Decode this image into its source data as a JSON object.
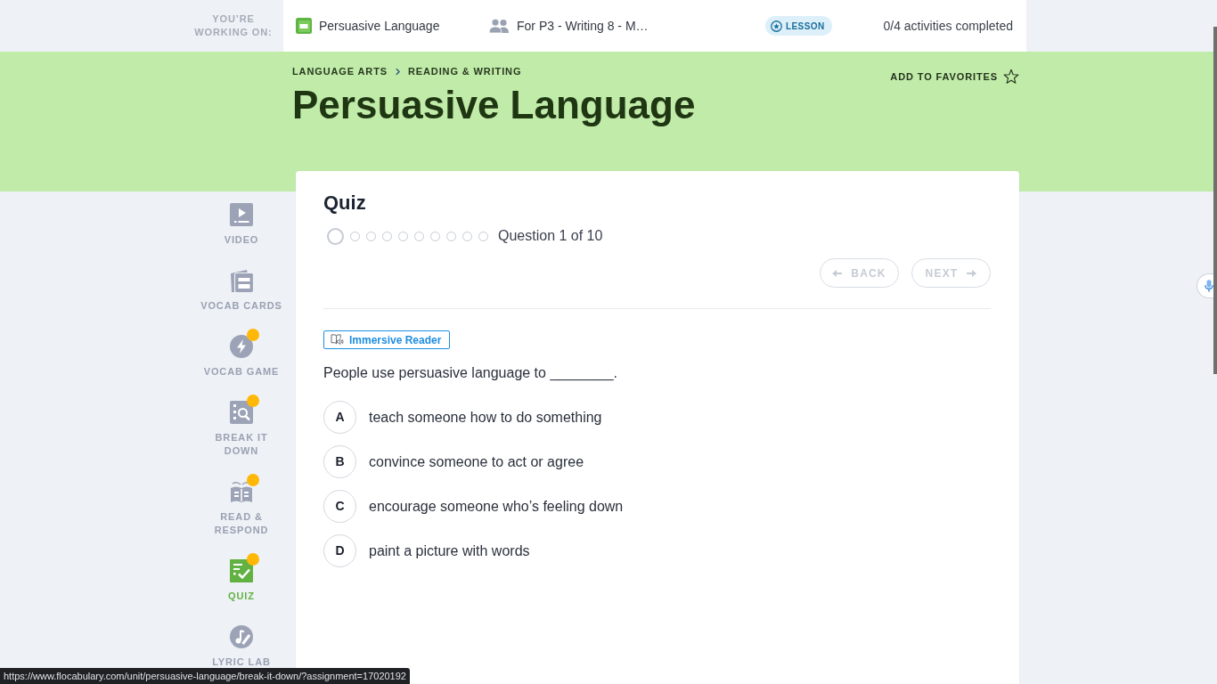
{
  "top_bar": {
    "working_on_label": "YOU’RE WORKING ON:",
    "lesson": "Persuasive Language",
    "class_name": "For P3 - Writing 8 - M…",
    "badge": "LESSON",
    "completed_text": "0/4 activities completed"
  },
  "header": {
    "breadcrumbs": [
      "LANGUAGE ARTS",
      "READING & WRITING"
    ],
    "title": "Persuasive Language",
    "favorite": {
      "label": "ADD TO FAVORITES",
      "on": false
    }
  },
  "sidebar": {
    "items": [
      {
        "label": "VIDEO",
        "selected": false,
        "new": false
      },
      {
        "label": "VOCAB CARDS",
        "selected": false,
        "new": false
      },
      {
        "label": "VOCAB GAME",
        "selected": false,
        "new": true
      },
      {
        "label": "BREAK IT DOWN",
        "selected": false,
        "new": true
      },
      {
        "label": "READ & RESPOND",
        "selected": false,
        "new": true
      },
      {
        "label": "QUIZ",
        "selected": true,
        "new": true
      },
      {
        "label": "LYRIC LAB",
        "selected": false,
        "new": false
      }
    ]
  },
  "quiz": {
    "title": "Quiz",
    "steps": [
      {
        "selected": true
      },
      {
        "selected": false
      },
      {
        "selected": false
      },
      {
        "selected": false
      },
      {
        "selected": false
      },
      {
        "selected": false
      },
      {
        "selected": false
      },
      {
        "selected": false
      },
      {
        "selected": false
      },
      {
        "selected": false
      }
    ],
    "counter": "Question 1 of 10",
    "back": {
      "label": "BACK",
      "disabled": true
    },
    "next": {
      "label": "NEXT",
      "disabled": true
    },
    "reader_button": "Immersive Reader",
    "question": "People use persuasive language to ________.",
    "options": [
      {
        "letter": "A",
        "text": "teach someone how to do something",
        "selected": false
      },
      {
        "letter": "B",
        "text": "convince someone to act or agree",
        "selected": false
      },
      {
        "letter": "C",
        "text": "encourage someone who’s feeling down",
        "selected": false
      },
      {
        "letter": "D",
        "text": "paint a picture with words",
        "selected": false
      }
    ]
  },
  "status_bar": {
    "url": "https://www.flocabulary.com/unit/persuasive-language/break-it-down/?assignment=17020192"
  }
}
